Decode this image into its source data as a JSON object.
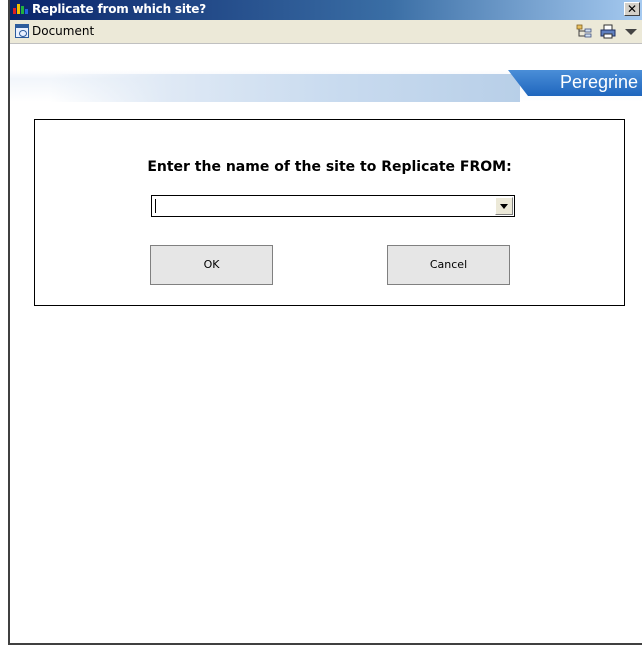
{
  "window": {
    "title": "Replicate from which site?",
    "close_glyph": "✕"
  },
  "toolbar": {
    "document_label": "Document",
    "icons": [
      "document-icon",
      "tree-view-icon",
      "print-icon",
      "dropdown-menu-icon"
    ]
  },
  "banner": {
    "brand": "Peregrine",
    "accent_color": "#1f66bd"
  },
  "dialog": {
    "prompt": "Enter the name of the site to Replicate FROM:",
    "site_select": {
      "value": ""
    },
    "ok_label": "OK",
    "cancel_label": "Cancel"
  }
}
